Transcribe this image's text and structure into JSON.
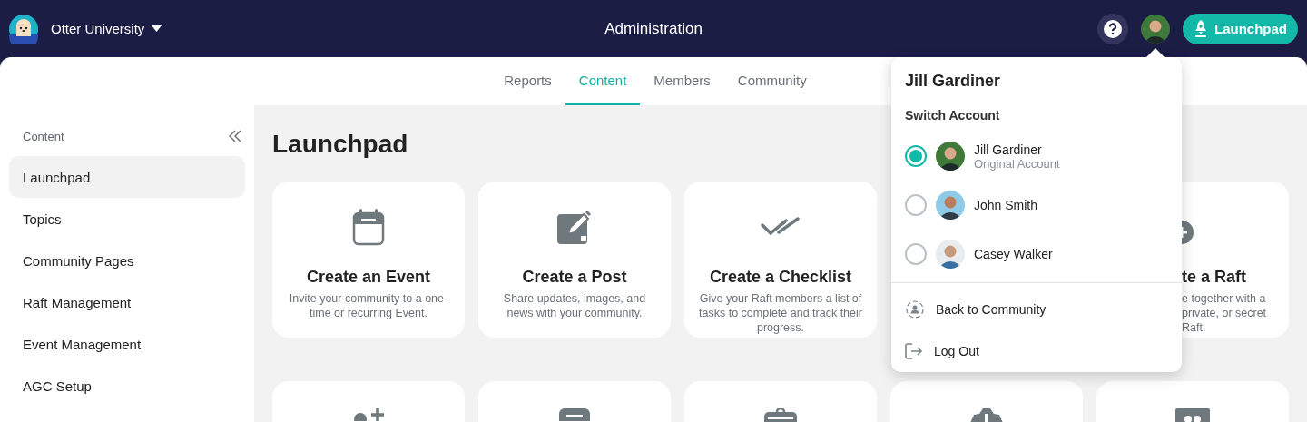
{
  "header": {
    "org": "Otter University",
    "title": "Administration",
    "launch_button": "Launchpad"
  },
  "tabs": [
    {
      "label": "Reports",
      "selected": false
    },
    {
      "label": "Content",
      "selected": true
    },
    {
      "label": "Members",
      "selected": false
    },
    {
      "label": "Community",
      "selected": false
    }
  ],
  "sidebar": {
    "heading": "Content",
    "items": [
      {
        "label": "Launchpad",
        "selected": true
      },
      {
        "label": "Topics",
        "selected": false
      },
      {
        "label": "Community Pages",
        "selected": false
      },
      {
        "label": "Raft Management",
        "selected": false
      },
      {
        "label": "Event Management",
        "selected": false
      },
      {
        "label": "AGC Setup",
        "selected": false
      }
    ]
  },
  "page_title": "Launchpad",
  "cards": [
    {
      "kind": "full",
      "title": "Create an Event",
      "description": "Invite your community to a one-time or recurring Event."
    },
    {
      "kind": "full",
      "title": "Create a Post",
      "description": "Share updates, images, and news with your community."
    },
    {
      "kind": "full",
      "title": "Create a Checklist",
      "description": "Give your Raft members a list of tasks to complete and track their progress."
    },
    {
      "kind": "partial",
      "title": "te a Raft",
      "lines": [
        "e together with a",
        "private, or secret",
        "Raft."
      ]
    }
  ],
  "account_menu": {
    "name": "Jill Gardiner",
    "section": "Switch Account",
    "accounts": [
      {
        "name": "Jill Gardiner",
        "note": "Original Account",
        "selected": true
      },
      {
        "name": "John Smith",
        "selected": false
      },
      {
        "name": "Casey Walker",
        "selected": false
      }
    ],
    "actions": [
      {
        "label": "Back to Community"
      },
      {
        "label": "Log Out"
      }
    ]
  }
}
